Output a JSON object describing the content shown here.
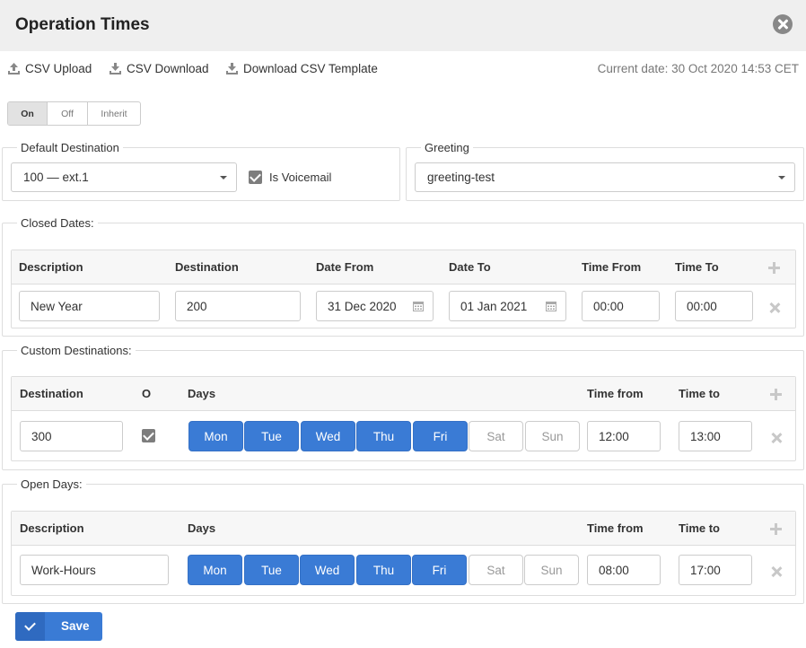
{
  "dialog": {
    "title": "Operation Times"
  },
  "toolbar": {
    "csv_upload": "CSV Upload",
    "csv_download": "CSV Download",
    "download_template": "Download CSV Template",
    "current_date": "Current date: 30 Oct 2020 14:53 CET"
  },
  "mode": {
    "options": [
      "On",
      "Off",
      "Inherit"
    ],
    "selected": "On"
  },
  "default_destination": {
    "legend": "Default Destination",
    "value": "100 — ext.1",
    "is_voicemail_label": "Is Voicemail",
    "is_voicemail_checked": true
  },
  "greeting": {
    "legend": "Greeting",
    "value": "greeting-test"
  },
  "closed_dates": {
    "legend": "Closed Dates:",
    "headers": [
      "Description",
      "Destination",
      "Date From",
      "Date To",
      "Time From",
      "Time To"
    ],
    "rows": [
      {
        "description": "New Year",
        "destination": "200",
        "date_from": "31 Dec 2020",
        "date_to": "01 Jan 2021",
        "time_from": "00:00",
        "time_to": "00:00"
      }
    ]
  },
  "custom_destinations": {
    "legend": "Custom Destinations:",
    "headers": [
      "Destination",
      "O",
      "Days",
      "Time from",
      "Time to"
    ],
    "rows": [
      {
        "destination": "300",
        "o_checked": true,
        "time_from": "12:00",
        "time_to": "13:00"
      }
    ]
  },
  "open_days": {
    "legend": "Open Days:",
    "headers": [
      "Description",
      "Days",
      "Time from",
      "Time to"
    ],
    "rows": [
      {
        "description": "Work-Hours",
        "time_from": "08:00",
        "time_to": "17:00"
      }
    ]
  },
  "days": [
    "Mon",
    "Tue",
    "Wed",
    "Thu",
    "Fri",
    "Sat",
    "Sun"
  ],
  "day_states": [
    true,
    true,
    true,
    true,
    true,
    false,
    false
  ],
  "save_label": "Save",
  "colors": {
    "accent": "#3a7bd5",
    "header_bg": "#efefef",
    "close_icon": "#888888"
  }
}
